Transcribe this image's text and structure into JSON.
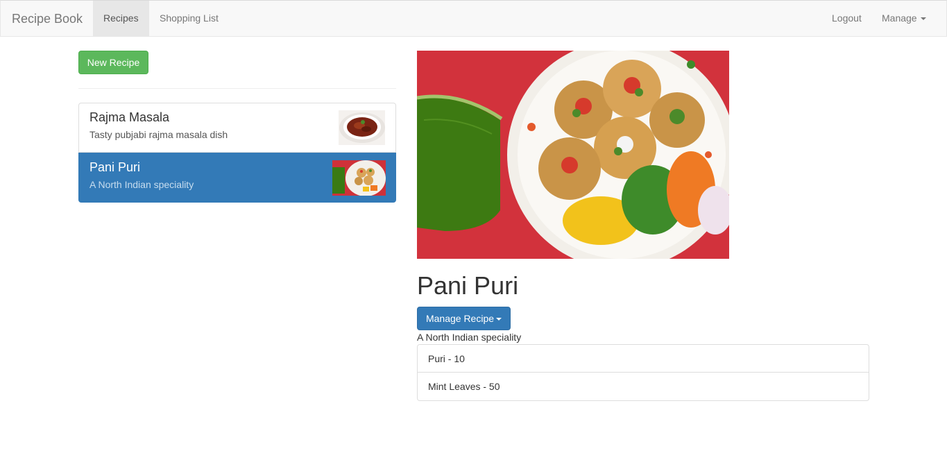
{
  "navbar": {
    "brand": "Recipe Book",
    "links": [
      "Recipes",
      "Shopping List"
    ],
    "right": {
      "logout": "Logout",
      "manage": "Manage"
    }
  },
  "sidebar": {
    "new_recipe_label": "New Recipe",
    "recipes": [
      {
        "name": "Rajma Masala",
        "description": "Tasty pubjabi rajma masala dish",
        "active": false
      },
      {
        "name": "Pani Puri",
        "description": "A North Indian speciality",
        "active": true
      }
    ]
  },
  "detail": {
    "title": "Pani Puri",
    "manage_label": "Manage Recipe",
    "description": "A North Indian speciality",
    "ingredients": [
      "Puri - 10",
      "Mint Leaves - 50"
    ]
  },
  "colors": {
    "primary": "#337ab7",
    "success": "#5cb85c",
    "navbar_bg": "#f8f8f8"
  }
}
